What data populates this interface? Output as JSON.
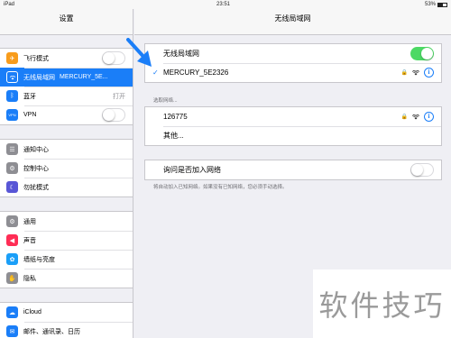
{
  "statusbar": {
    "device": "iPad",
    "wifi_icon": "wifi-icon",
    "time": "23:51",
    "battery": "53%",
    "battery_level": 0.53
  },
  "sidebar": {
    "title": "设置",
    "group1": [
      {
        "label": "飞行模式",
        "icon": "airplane-icon",
        "color": "#f89c1c",
        "toggle": false
      },
      {
        "label": "无线局域网",
        "value": "MERCURY_5E...",
        "icon": "wifi-icon",
        "color": "#1a7ef8",
        "selected": true
      },
      {
        "label": "蓝牙",
        "value": "打开",
        "icon": "bluetooth-icon",
        "color": "#1a7ef8"
      },
      {
        "label": "VPN",
        "icon": "vpn-icon",
        "color": "#1a7ef8",
        "icon_text": "VPN",
        "toggle": false
      }
    ],
    "group2": [
      {
        "label": "通知中心",
        "icon": "notification-icon",
        "color": "#8e8e93"
      },
      {
        "label": "控制中心",
        "icon": "control-center-icon",
        "color": "#8e8e93"
      },
      {
        "label": "勿扰模式",
        "icon": "moon-icon",
        "color": "#5856d6"
      }
    ],
    "group3": [
      {
        "label": "通用",
        "icon": "gear-icon",
        "color": "#8e8e93"
      },
      {
        "label": "声音",
        "icon": "speaker-icon",
        "color": "#ff2d55"
      },
      {
        "label": "墙纸与亮度",
        "icon": "flower-icon",
        "color": "#1a9ff8"
      },
      {
        "label": "隐私",
        "icon": "hand-icon",
        "color": "#8e8e93"
      }
    ],
    "group4": [
      {
        "label": "iCloud",
        "icon": "cloud-icon",
        "color": "#1a7ef8"
      },
      {
        "label": "邮件、通讯录、日历",
        "icon": "mail-icon",
        "color": "#1a7ef8"
      }
    ]
  },
  "main": {
    "title": "无线局域网",
    "wifi_label": "无线局域网",
    "wifi_on": true,
    "connected": {
      "name": "MERCURY_5E2326",
      "check": "✓",
      "info": "i"
    },
    "choose_network": "选取网络...",
    "networks": [
      {
        "name": "126775",
        "info": "i"
      },
      {
        "name": "其他..."
      }
    ],
    "ask_label": "询问是否加入网络",
    "ask_on": false,
    "ask_note": "将自动加入已知网络。如果没有已知网络，您必须手动选择。"
  },
  "watermark": "软件技巧",
  "colors": {
    "accent": "#1a7ef8",
    "switch_on": "#4cd964"
  }
}
